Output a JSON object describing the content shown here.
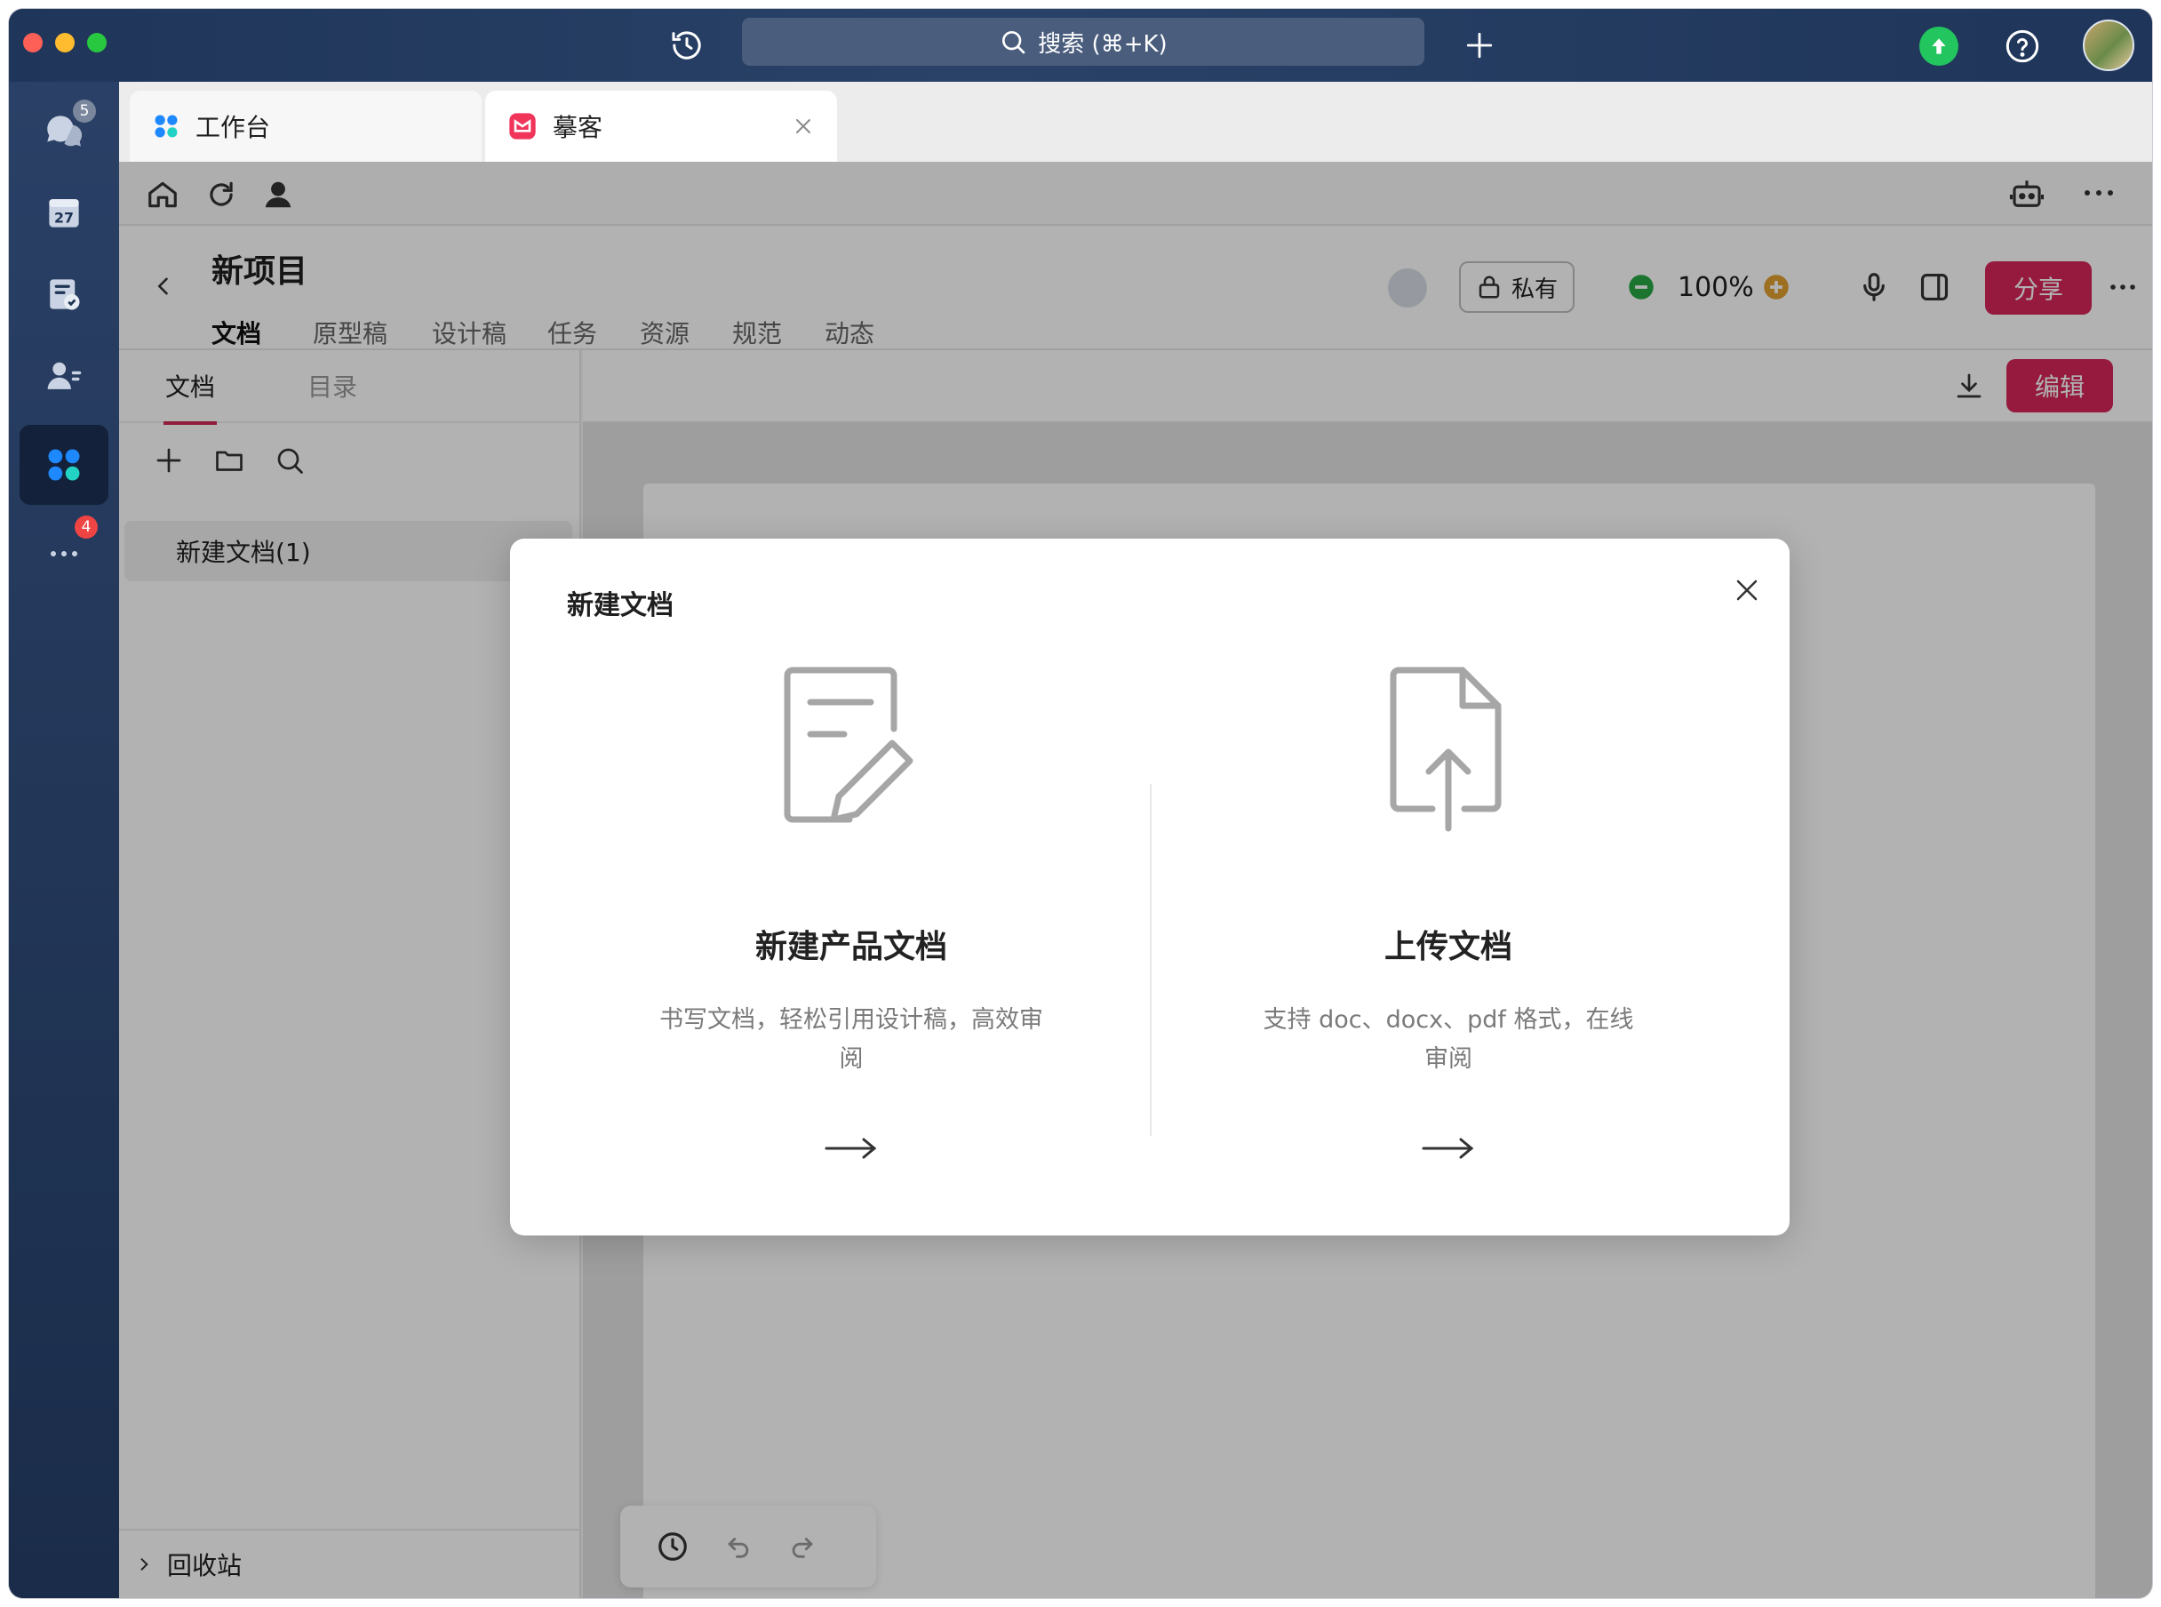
{
  "window": {
    "search_placeholder": "搜索 (⌘+K)"
  },
  "rail": {
    "messages_badge": "5",
    "calendar_day": "27",
    "more_badge": "4"
  },
  "tabs": [
    {
      "label": "工作台"
    },
    {
      "label": "摹客"
    }
  ],
  "project": {
    "title": "新项目",
    "tabs": [
      "文档",
      "原型稿",
      "设计稿",
      "任务",
      "资源",
      "规范",
      "动态"
    ],
    "privacy_label": "私有",
    "zoom": "100%",
    "share_label": "分享"
  },
  "sidebar": {
    "tabs": [
      "文档",
      "目录"
    ],
    "doc_item": "新建文档(1)",
    "trash_label": "回收站"
  },
  "canvas": {
    "edit_label": "编辑"
  },
  "modal": {
    "title": "新建文档",
    "cards": [
      {
        "title": "新建产品文档",
        "desc": "书写文档，轻松引用设计稿，高效审阅"
      },
      {
        "title": "上传文档",
        "desc": "支持 doc、docx、pdf 格式，在线审阅"
      }
    ]
  },
  "colors": {
    "accent": "#d6265a",
    "rail_bg": "#1d3354",
    "zoom_minus": "#27a844",
    "zoom_plus": "#e0a030",
    "upgrade_green": "#22c55e",
    "badge_red": "#ef4444"
  }
}
